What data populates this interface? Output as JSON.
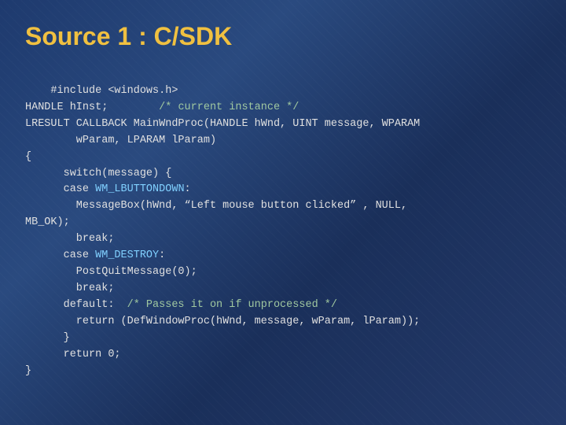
{
  "slide": {
    "title": "Source 1 : C/SDK",
    "code": {
      "lines": [
        {
          "id": "line1",
          "text": "#include <windows.h>"
        },
        {
          "id": "line2",
          "parts": [
            {
              "type": "plain",
              "text": "HANDLE hInst;        "
            },
            {
              "type": "comment",
              "text": "/* current instance */"
            }
          ]
        },
        {
          "id": "line3",
          "text": "LRESULT CALLBACK MainWndProc(HANDLE hWnd, UINT message, WPARAM"
        },
        {
          "id": "line4",
          "text": "        wParam, LPARAM lParam)"
        },
        {
          "id": "line5",
          "text": "{"
        },
        {
          "id": "line6",
          "text": "      switch(message) {"
        },
        {
          "id": "line7",
          "text": "      case WM_LBUTTONDOWN:"
        },
        {
          "id": "line8",
          "text": "        MessageBox(hWnd, “Left mouse button clicked” , NULL,"
        },
        {
          "id": "line9",
          "text": "MB_OK);"
        },
        {
          "id": "line10",
          "text": "        break;"
        },
        {
          "id": "line11",
          "text": "      case WM_DESTROY:"
        },
        {
          "id": "line12",
          "text": "        PostQuitMessage(0);"
        },
        {
          "id": "line13",
          "text": "        break;"
        },
        {
          "id": "line14",
          "parts": [
            {
              "type": "plain",
              "text": "      default:  "
            },
            {
              "type": "comment",
              "text": "/* Passes it on if unprocessed */"
            }
          ]
        },
        {
          "id": "line15",
          "text": "        return (DefWindowProc(hWnd, message, wParam, lParam));"
        },
        {
          "id": "line16",
          "text": "      }"
        },
        {
          "id": "line17",
          "text": "      return 0;"
        },
        {
          "id": "line18",
          "text": "}"
        }
      ]
    }
  }
}
